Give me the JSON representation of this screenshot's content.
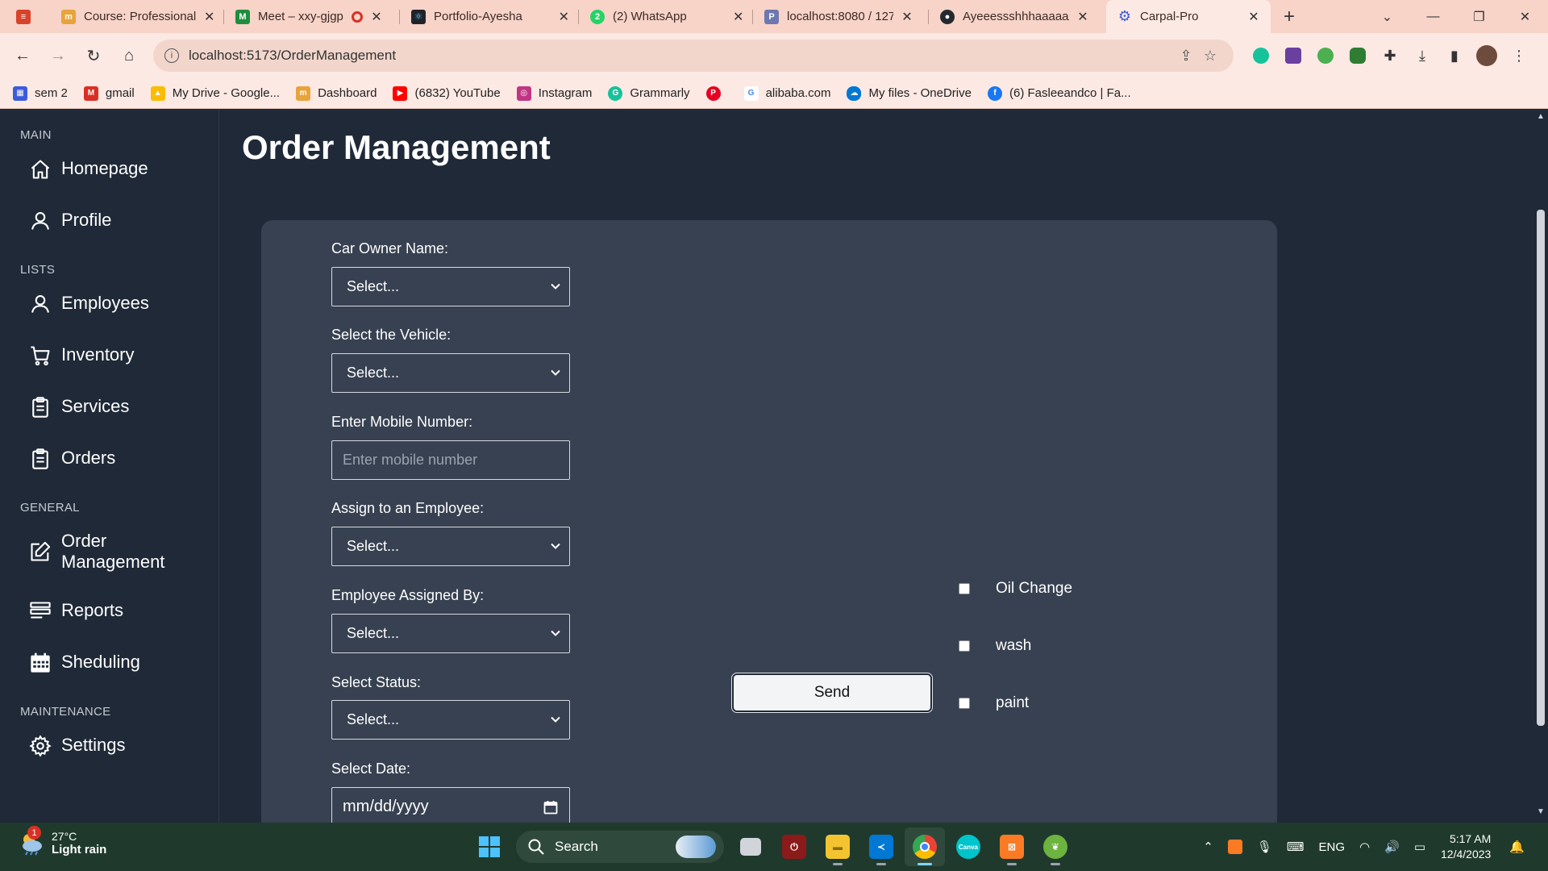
{
  "browser": {
    "tabs": [
      {
        "title": "Course: Professional",
        "icon_color": "#d8432b",
        "icon": "book-icon"
      },
      {
        "title": "Meet – xxy-gjgp",
        "icon_color": "#1e8e3e",
        "icon": "meet-icon",
        "recording": true
      },
      {
        "title": "Portfolio-Ayesha",
        "icon_color": "#20232a",
        "icon": "react-icon"
      },
      {
        "title": "(2) WhatsApp",
        "icon_color": "#25d366",
        "icon": "whatsapp-icon"
      },
      {
        "title": "localhost:8080 / 127",
        "icon_color": "#6c78af",
        "icon": "phpmyadmin-icon"
      },
      {
        "title": "Ayeeessshhhaaaaa/(",
        "icon_color": "#24292f",
        "icon": "github-icon"
      },
      {
        "title": "Carpal-Pro",
        "icon_color": "#3b5bdb",
        "icon": "gear-icon",
        "active": true
      }
    ],
    "new_tab_label": "+",
    "url": "localhost:5173/OrderManagement",
    "bookmarks": [
      {
        "label": "sem 2",
        "color": "#3b5bdb"
      },
      {
        "label": "gmail",
        "color": "#d93025"
      },
      {
        "label": "My Drive - Google...",
        "color": "#1a73e8"
      },
      {
        "label": "Dashboard",
        "color": "#f57c00"
      },
      {
        "label": "(6832) YouTube",
        "color": "#ff0000"
      },
      {
        "label": "Instagram",
        "color": "#c13584"
      },
      {
        "label": "Grammarly",
        "color": "#15c39a"
      },
      {
        "label": "",
        "color": "#e60023"
      },
      {
        "label": "alibaba.com",
        "color": "#ff6a00"
      },
      {
        "label": "My files - OneDrive",
        "color": "#0078d4"
      },
      {
        "label": "(6) Fasleeandco | Fa...",
        "color": "#1877f2"
      }
    ]
  },
  "sidebar": {
    "sections": [
      {
        "label": "MAIN",
        "items": [
          {
            "label": "Homepage",
            "icon": "home-icon"
          },
          {
            "label": "Profile",
            "icon": "user-icon"
          }
        ]
      },
      {
        "label": "LISTS",
        "items": [
          {
            "label": "Employees",
            "icon": "user-icon"
          },
          {
            "label": "Inventory",
            "icon": "cart-icon"
          },
          {
            "label": "Services",
            "icon": "clipboard-icon"
          },
          {
            "label": "Orders",
            "icon": "clipboard-icon"
          }
        ]
      },
      {
        "label": "GENERAL",
        "items": [
          {
            "label": "Order Management",
            "icon": "edit-icon"
          },
          {
            "label": "Reports",
            "icon": "reports-icon"
          },
          {
            "label": "Sheduling",
            "icon": "calendar-icon"
          }
        ]
      },
      {
        "label": "MAINTENANCE",
        "items": [
          {
            "label": "Settings",
            "icon": "gear-icon"
          }
        ]
      }
    ]
  },
  "main": {
    "title": "Order Management",
    "form": {
      "owner_label": "Car Owner Name:",
      "owner_value": "Select...",
      "vehicle_label": "Select the Vehicle:",
      "vehicle_value": "Select...",
      "mobile_label": "Enter Mobile Number:",
      "mobile_placeholder": "Enter mobile number",
      "employee_label": "Assign to an Employee:",
      "employee_value": "Select...",
      "assigned_by_label": "Employee Assigned By:",
      "assigned_by_value": "Select...",
      "status_label": "Select Status:",
      "status_value": "Select...",
      "date_label": "Select Date:",
      "date_placeholder": "mm/dd/yyyy"
    },
    "send_label": "Send",
    "services": [
      "Oil Change",
      "wash",
      "paint"
    ]
  },
  "taskbar": {
    "weather_temp": "27°C",
    "weather_desc": "Light rain",
    "weather_badge": "1",
    "search_label": "Search",
    "lang": "ENG",
    "time": "5:17 AM",
    "date": "12/4/2023"
  }
}
